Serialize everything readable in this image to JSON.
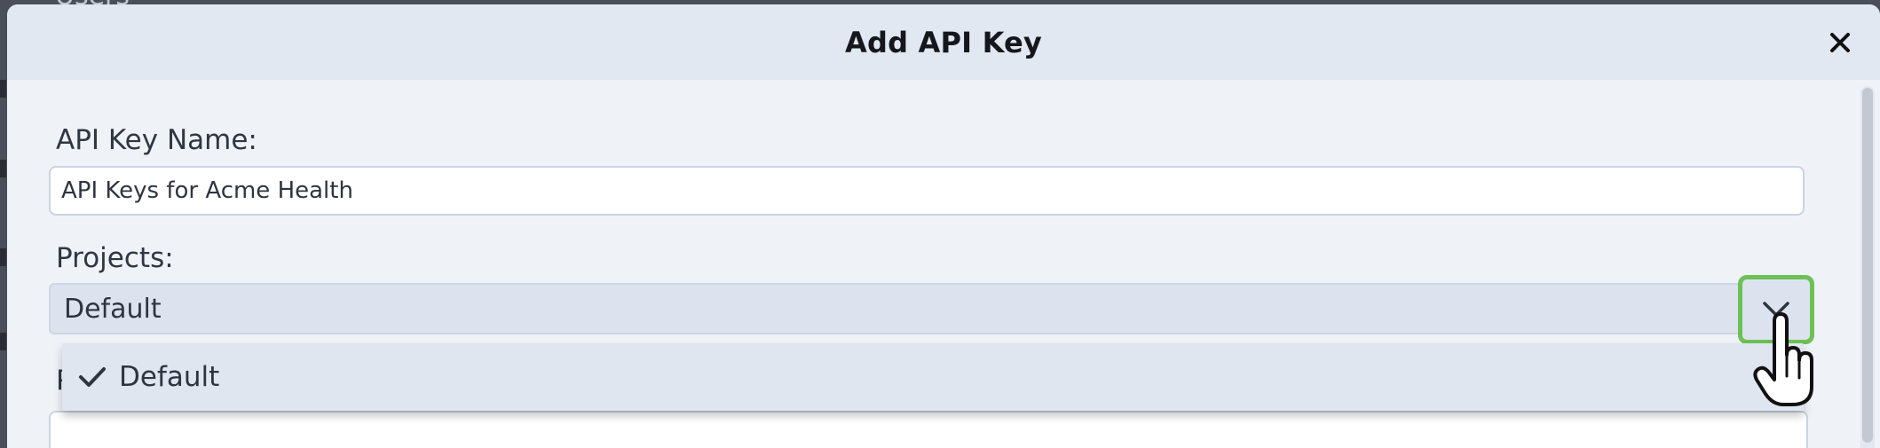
{
  "background": {
    "title_fragment": "Users"
  },
  "modal": {
    "title": "Add API Key",
    "close_label": "×"
  },
  "form": {
    "api_key_name": {
      "label": "API Key Name:",
      "value": "API Keys for Acme Health"
    },
    "projects": {
      "label": "Projects:",
      "selected": "Default",
      "options": [
        "Default"
      ]
    },
    "next_field_label_initial": "P"
  },
  "colors": {
    "accent_focus": "#6cc155",
    "header_bg": "#e1e8f1",
    "body_bg": "#eff2f7"
  },
  "icons": {
    "close": "close-icon",
    "dropdown": "chevron-down-icon",
    "selected_option": "checkmark-icon",
    "pointer": "hand-cursor-icon"
  }
}
